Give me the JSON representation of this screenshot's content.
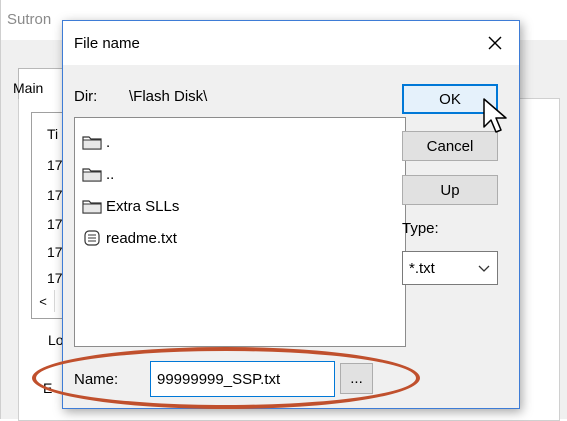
{
  "background_window": {
    "title": "Sutron",
    "tab_label": "Main",
    "list_rows": [
      "Ti",
      "17",
      "17",
      "17",
      "17",
      "17"
    ],
    "scroll_left": "<",
    "label_lo": "Lo",
    "label_e": "E"
  },
  "dialog": {
    "title": "File name",
    "close_glyph": "✕",
    "dir_label": "Dir:",
    "dir_value": "\\Flash Disk\\",
    "files": [
      {
        "name": ".",
        "icon": "folder-icon"
      },
      {
        "name": "..",
        "icon": "folder-icon"
      },
      {
        "name": "Extra SLLs",
        "icon": "folder-icon"
      },
      {
        "name": "readme.txt",
        "icon": "text-file-icon"
      }
    ],
    "buttons": {
      "ok": "OK",
      "cancel": "Cancel",
      "up": "Up"
    },
    "type_label": "Type:",
    "type_value": "*.txt",
    "name_label": "Name:",
    "name_value": "99999999_SSP.txt",
    "browse_label": "...",
    "highlight_color": "#c0502d",
    "accent_color": "#0078d7"
  }
}
